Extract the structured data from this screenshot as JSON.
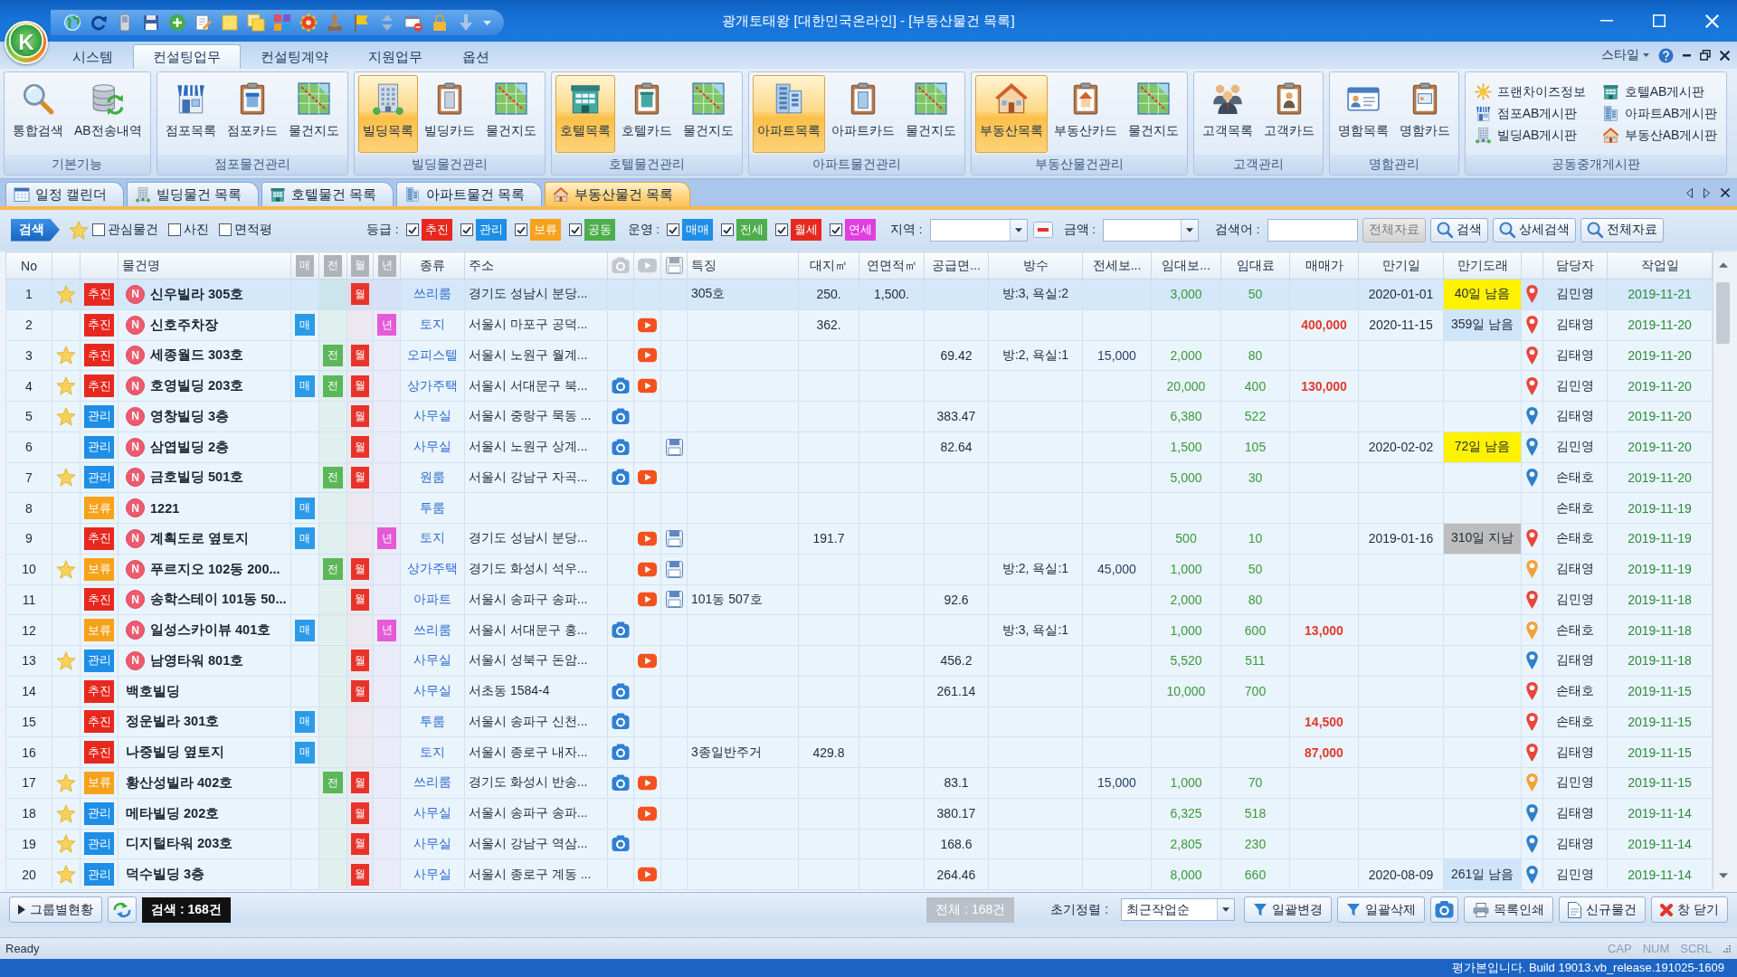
{
  "window": {
    "logo": "K",
    "title": "광개토태왕 [대한민국온라인] - [부동산물건 목록]"
  },
  "ribbon_tabs": [
    {
      "label": "시스템",
      "selected": false
    },
    {
      "label": "컨설팅업무",
      "selected": true
    },
    {
      "label": "컨설팅계약",
      "selected": false
    },
    {
      "label": "지원업무",
      "selected": false
    },
    {
      "label": "옵션",
      "selected": false
    }
  ],
  "style_menu": "스타일",
  "ribbon_groups": [
    {
      "title": "기본기능",
      "buttons": [
        {
          "label": "통합검색",
          "kind": "magnifier",
          "selected": false
        },
        {
          "label": "AB전송내역",
          "kind": "database",
          "selected": false
        }
      ]
    },
    {
      "title": "점포물건관리",
      "buttons": [
        {
          "label": "점포목록",
          "kind": "shop",
          "selected": false
        },
        {
          "label": "점포카드",
          "kind": "shop-card",
          "selected": false
        },
        {
          "label": "물건지도",
          "kind": "map",
          "selected": false
        }
      ]
    },
    {
      "title": "빌딩물건관리",
      "buttons": [
        {
          "label": "빌딩목록",
          "kind": "office",
          "selected": true
        },
        {
          "label": "빌딩카드",
          "kind": "office-card",
          "selected": false
        },
        {
          "label": "물건지도",
          "kind": "map",
          "selected": false
        }
      ]
    },
    {
      "title": "호텔물건관리",
      "buttons": [
        {
          "label": "호텔목록",
          "kind": "hotel",
          "selected": true
        },
        {
          "label": "호텔카드",
          "kind": "hotel-card",
          "selected": false
        },
        {
          "label": "물건지도",
          "kind": "map",
          "selected": false
        }
      ]
    },
    {
      "title": "아파트물건관리",
      "buttons": [
        {
          "label": "아파트목록",
          "kind": "apartment",
          "selected": true
        },
        {
          "label": "아파트카드",
          "kind": "apartment-card",
          "selected": false
        },
        {
          "label": "물건지도",
          "kind": "map",
          "selected": false
        }
      ]
    },
    {
      "title": "부동산물건관리",
      "buttons": [
        {
          "label": "부동산목록",
          "kind": "house",
          "selected": true
        },
        {
          "label": "부동산카드",
          "kind": "house-card",
          "selected": false
        },
        {
          "label": "물건지도",
          "kind": "map",
          "selected": false
        }
      ]
    },
    {
      "title": "고객관리",
      "buttons": [
        {
          "label": "고객목록",
          "kind": "people",
          "selected": false
        },
        {
          "label": "고객카드",
          "kind": "person-card",
          "selected": false
        }
      ]
    },
    {
      "title": "명함관리",
      "buttons": [
        {
          "label": "명함목록",
          "kind": "contact-list",
          "selected": false
        },
        {
          "label": "명함카드",
          "kind": "contact-card",
          "selected": false
        }
      ]
    }
  ],
  "board_group": {
    "title": "공동중개게시판",
    "links": [
      {
        "label": "프랜차이즈정보",
        "kind": "sun"
      },
      {
        "label": "호텔AB게시판",
        "kind": "hotel"
      },
      {
        "label": "점포AB게시판",
        "kind": "shop"
      },
      {
        "label": "아파트AB게시판",
        "kind": "apartment"
      },
      {
        "label": "빌딩AB게시판",
        "kind": "office"
      },
      {
        "label": "부동산AB게시판",
        "kind": "house"
      }
    ]
  },
  "doc_tabs": [
    {
      "label": "일정 캘린더",
      "kind": "calendar",
      "selected": false
    },
    {
      "label": "빌딩물건 목록",
      "kind": "office",
      "selected": false
    },
    {
      "label": "호텔물건 목록",
      "kind": "hotel",
      "selected": false
    },
    {
      "label": "아파트물건 목록",
      "kind": "apartment",
      "selected": false
    },
    {
      "label": "부동산물건 목록",
      "kind": "house",
      "selected": true
    }
  ],
  "filter_bar": {
    "search_label": "검색",
    "checks": [
      {
        "label": "관심물건",
        "checked": false
      },
      {
        "label": "사진",
        "checked": false
      },
      {
        "label": "면적평",
        "checked": false
      }
    ],
    "grade": {
      "label": "등급 :",
      "options": [
        {
          "label": "추진",
          "checked": true,
          "color": "#e8281e"
        },
        {
          "label": "관리",
          "checked": true,
          "color": "#1e8ee6"
        },
        {
          "label": "보류",
          "checked": true,
          "color": "#f7a21b"
        },
        {
          "label": "공동",
          "checked": true,
          "color": "#4cae4c"
        }
      ]
    },
    "operation": {
      "label": "운영 :",
      "options": [
        {
          "label": "매매",
          "checked": true,
          "color": "#1e8ee6"
        },
        {
          "label": "전세",
          "checked": true,
          "color": "#4cae4c"
        },
        {
          "label": "월세",
          "checked": true,
          "color": "#e8281e"
        },
        {
          "label": "연세",
          "checked": true,
          "color": "#e03ee0"
        }
      ]
    },
    "region_label": "지역 :",
    "amount_label": "금액 :",
    "keyword_label": "검색어 :",
    "buttons": [
      {
        "label": "전체자료",
        "kind": "plain",
        "disabled": true
      },
      {
        "label": "검색",
        "kind": "search",
        "disabled": false
      },
      {
        "label": "상세검색",
        "kind": "search",
        "disabled": false
      },
      {
        "label": "전체자료",
        "kind": "search",
        "disabled": false
      }
    ]
  },
  "table": {
    "columns": [
      {
        "kind": "text",
        "label": "No"
      },
      {
        "kind": "empty"
      },
      {
        "kind": "empty"
      },
      {
        "kind": "text",
        "label": "물건명"
      },
      {
        "kind": "flag",
        "label": "매"
      },
      {
        "kind": "flag",
        "label": "전"
      },
      {
        "kind": "flag",
        "label": "월"
      },
      {
        "kind": "flag",
        "label": "년"
      },
      {
        "kind": "text",
        "label": "종류"
      },
      {
        "kind": "text",
        "label": "주소"
      },
      {
        "kind": "photo"
      },
      {
        "kind": "video"
      },
      {
        "kind": "file"
      },
      {
        "kind": "text",
        "label": "특징"
      },
      {
        "kind": "text",
        "label": "대지㎡"
      },
      {
        "kind": "text",
        "label": "연면적㎡"
      },
      {
        "kind": "text",
        "label": "공급면..."
      },
      {
        "kind": "text",
        "label": "방수"
      },
      {
        "kind": "text",
        "label": "전세보..."
      },
      {
        "kind": "text",
        "label": "임대보..."
      },
      {
        "kind": "text",
        "label": "임대료"
      },
      {
        "kind": "text",
        "label": "매매가"
      },
      {
        "kind": "text",
        "label": "만기일"
      },
      {
        "kind": "text",
        "label": "만기도래"
      },
      {
        "kind": "empty"
      },
      {
        "kind": "text",
        "label": "담당자"
      },
      {
        "kind": "text",
        "label": "작업일"
      }
    ],
    "rows": [
      {
        "no": "1",
        "selected": true,
        "starred": true,
        "status": {
          "label": "추진",
          "color": "#e8281e"
        },
        "new_badge": "N",
        "name": "신우빌라 305호",
        "monthly": "월",
        "type": "쓰리룸",
        "address": "경기도 성남시 분당...",
        "photo": false,
        "video": false,
        "file": false,
        "feature": "305호",
        "land_area": "250.",
        "floor_area": "1,500.",
        "rooms": "방:3, 욕실:2",
        "deposit": "3,000",
        "rent": "50",
        "expiry": "2020-01-01",
        "due": {
          "text": "40일 남음",
          "color": "#fff200"
        },
        "pin": {
          "color": "#e8453c"
        },
        "agent": "김민영",
        "work_date": "2019-11-21"
      },
      {
        "no": "2",
        "selected": false,
        "starred": false,
        "status": {
          "label": "추진",
          "color": "#e8281e"
        },
        "new_badge": "N",
        "name": "신호주차장",
        "sale": "매",
        "yearly": "년",
        "type": "토지",
        "address": "서울시 마포구 공덕...",
        "photo": false,
        "video": true,
        "file": false,
        "land_area": "362.",
        "price": "400,000",
        "expiry": "2020-11-15",
        "due": {
          "text": "359일 남음",
          "color": "#cfe6fa"
        },
        "pin": {
          "color": "#e8453c"
        },
        "agent": "김태영",
        "work_date": "2019-11-20"
      },
      {
        "no": "3",
        "selected": false,
        "starred": true,
        "status": {
          "label": "추진",
          "color": "#e8281e"
        },
        "new_badge": "N",
        "name": "세종월드 303호",
        "jeonse": "전",
        "monthly": "월",
        "type": "오피스텔",
        "address": "서울시 노원구 월계...",
        "photo": false,
        "video": true,
        "file": false,
        "supply_area": "69.42",
        "rooms": "방:2, 욕실:1",
        "jeonse_deposit": "15,000",
        "deposit": "2,000",
        "rent": "80",
        "pin": {
          "color": "#e8453c"
        },
        "agent": "김태영",
        "work_date": "2019-11-20"
      },
      {
        "no": "4",
        "selected": false,
        "starred": true,
        "status": {
          "label": "추진",
          "color": "#e8281e"
        },
        "new_badge": "N",
        "name": "호영빌딩 203호",
        "sale": "매",
        "jeonse": "전",
        "monthly": "월",
        "type": "상가주택",
        "address": "서울시 서대문구 북...",
        "photo": true,
        "video": true,
        "file": false,
        "deposit": "20,000",
        "rent": "400",
        "price": "130,000",
        "pin": {
          "color": "#e8453c"
        },
        "agent": "김민영",
        "work_date": "2019-11-20"
      },
      {
        "no": "5",
        "selected": false,
        "starred": true,
        "status": {
          "label": "관리",
          "color": "#1e8ee6"
        },
        "new_badge": "N",
        "name": "영창빌딩 3층",
        "monthly": "월",
        "type": "사무실",
        "address": "서울시 중랑구 묵동 ...",
        "photo": true,
        "video": false,
        "file": false,
        "supply_area": "383.47",
        "deposit": "6,380",
        "rent": "522",
        "pin": {
          "color": "#2f80c8"
        },
        "agent": "김태영",
        "work_date": "2019-11-20"
      },
      {
        "no": "6",
        "selected": false,
        "starred": false,
        "status": {
          "label": "관리",
          "color": "#1e8ee6"
        },
        "new_badge": "N",
        "name": "삼엽빌딩 2층",
        "monthly": "월",
        "type": "사무실",
        "address": "서울시 노원구 상계...",
        "photo": true,
        "video": false,
        "file": true,
        "supply_area": "82.64",
        "deposit": "1,500",
        "rent": "105",
        "expiry": "2020-02-02",
        "due": {
          "text": "72일 남음",
          "color": "#fff200"
        },
        "pin": {
          "color": "#2f80c8"
        },
        "agent": "김민영",
        "work_date": "2019-11-20"
      },
      {
        "no": "7",
        "selected": false,
        "starred": true,
        "status": {
          "label": "관리",
          "color": "#1e8ee6"
        },
        "new_badge": "N",
        "name": "금호빌딩 501호",
        "jeonse": "전",
        "monthly": "월",
        "type": "원룸",
        "address": "서울시 강남구 자곡...",
        "photo": true,
        "video": true,
        "file": false,
        "deposit": "5,000",
        "rent": "30",
        "pin": {
          "color": "#2f80c8"
        },
        "agent": "손태호",
        "work_date": "2019-11-20"
      },
      {
        "no": "8",
        "selected": false,
        "starred": false,
        "status": {
          "label": "보류",
          "color": "#f7a21b"
        },
        "new_badge": "N",
        "name": "1221",
        "sale": "매",
        "type": "투룸",
        "photo": false,
        "video": false,
        "file": false,
        "agent": "손태호",
        "work_date": "2019-11-19"
      },
      {
        "no": "9",
        "selected": false,
        "starred": false,
        "status": {
          "label": "추진",
          "color": "#e8281e"
        },
        "new_badge": "N",
        "name": "계획도로 옆토지",
        "sale": "매",
        "yearly": "년",
        "type": "토지",
        "address": "경기도 성남시 분당...",
        "photo": false,
        "video": true,
        "file": true,
        "land_area": "191.7",
        "deposit": "500",
        "rent": "10",
        "expiry": "2019-01-16",
        "due": {
          "text": "310일 지남",
          "color": "#bdbdbd"
        },
        "pin": {
          "color": "#e8453c"
        },
        "agent": "손태호",
        "work_date": "2019-11-19"
      },
      {
        "no": "10",
        "selected": false,
        "starred": true,
        "status": {
          "label": "보류",
          "color": "#f7a21b"
        },
        "new_badge": "N",
        "name": "푸르지오 102동 200...",
        "jeonse": "전",
        "monthly": "월",
        "type": "상가주택",
        "address": "경기도 화성시 석우...",
        "photo": false,
        "video": true,
        "file": true,
        "rooms": "방:2, 욕실:1",
        "jeonse_deposit": "45,000",
        "deposit": "1,000",
        "rent": "50",
        "pin": {
          "color": "#f0a33a"
        },
        "agent": "김태영",
        "work_date": "2019-11-19"
      },
      {
        "no": "11",
        "selected": false,
        "starred": false,
        "status": {
          "label": "추진",
          "color": "#e8281e"
        },
        "new_badge": "N",
        "name": "송학스테이 101동 50...",
        "monthly": "월",
        "type": "아파트",
        "address": "서울시 송파구 송파...",
        "photo": false,
        "video": true,
        "file": true,
        "feature": "101동 507호",
        "supply_area": "92.6",
        "deposit": "2,000",
        "rent": "80",
        "pin": {
          "color": "#e8453c"
        },
        "agent": "김민영",
        "work_date": "2019-11-18"
      },
      {
        "no": "12",
        "selected": false,
        "starred": false,
        "status": {
          "label": "보류",
          "color": "#f7a21b"
        },
        "new_badge": "N",
        "name": "일성스카이뷰 401호",
        "sale": "매",
        "yearly": "년",
        "type": "쓰리룸",
        "address": "서울시 서대문구 홍...",
        "photo": true,
        "video": false,
        "file": false,
        "rooms": "방:3, 욕실:1",
        "deposit": "1,000",
        "rent": "600",
        "price": "13,000",
        "pin": {
          "color": "#f0a33a"
        },
        "agent": "손태호",
        "work_date": "2019-11-18"
      },
      {
        "no": "13",
        "selected": false,
        "starred": true,
        "status": {
          "label": "관리",
          "color": "#1e8ee6"
        },
        "new_badge": "N",
        "name": "남영타워 801호",
        "monthly": "월",
        "type": "사무실",
        "address": "서울시 성북구 돈암...",
        "photo": false,
        "video": true,
        "file": false,
        "supply_area": "456.2",
        "deposit": "5,520",
        "rent": "511",
        "pin": {
          "color": "#2f80c8"
        },
        "agent": "김태영",
        "work_date": "2019-11-18"
      },
      {
        "no": "14",
        "selected": false,
        "starred": false,
        "status": {
          "label": "추진",
          "color": "#e8281e"
        },
        "name": "백호빌딩",
        "monthly": "월",
        "type": "사무실",
        "address": "서초동 1584-4",
        "photo": true,
        "video": false,
        "file": false,
        "supply_area": "261.14",
        "deposit": "10,000",
        "rent": "700",
        "pin": {
          "color": "#e8453c"
        },
        "agent": "손태호",
        "work_date": "2019-11-15"
      },
      {
        "no": "15",
        "selected": false,
        "starred": false,
        "status": {
          "label": "추진",
          "color": "#e8281e"
        },
        "name": "정운빌라 301호",
        "sale": "매",
        "type": "투룸",
        "address": "서울시 송파구 신천...",
        "photo": true,
        "video": false,
        "file": false,
        "price": "14,500",
        "pin": {
          "color": "#e8453c"
        },
        "agent": "손태호",
        "work_date": "2019-11-15"
      },
      {
        "no": "16",
        "selected": false,
        "starred": false,
        "status": {
          "label": "추진",
          "color": "#e8281e"
        },
        "name": "나중빌딩 옆토지",
        "sale": "매",
        "type": "토지",
        "address": "서울시 종로구 내자...",
        "photo": true,
        "video": false,
        "file": false,
        "feature": "3종일반주거",
        "land_area": "429.8",
        "price": "87,000",
        "pin": {
          "color": "#e8453c"
        },
        "agent": "김태영",
        "work_date": "2019-11-15"
      },
      {
        "no": "17",
        "selected": false,
        "starred": true,
        "status": {
          "label": "보류",
          "color": "#f7a21b"
        },
        "name": "황산성빌라 402호",
        "jeonse": "전",
        "monthly": "월",
        "type": "쓰리룸",
        "address": "경기도 화성시 반송...",
        "photo": true,
        "video": true,
        "file": false,
        "supply_area": "83.1",
        "jeonse_deposit": "15,000",
        "deposit": "1,000",
        "rent": "70",
        "pin": {
          "color": "#f0a33a"
        },
        "agent": "김민영",
        "work_date": "2019-11-15"
      },
      {
        "no": "18",
        "selected": false,
        "starred": true,
        "status": {
          "label": "관리",
          "color": "#1e8ee6"
        },
        "name": "메타빌딩 202호",
        "monthly": "월",
        "type": "사무실",
        "address": "서울시 송파구 송파...",
        "photo": false,
        "video": true,
        "file": false,
        "supply_area": "380.17",
        "deposit": "6,325",
        "rent": "518",
        "pin": {
          "color": "#2f80c8"
        },
        "agent": "김태영",
        "work_date": "2019-11-14"
      },
      {
        "no": "19",
        "selected": false,
        "starred": true,
        "status": {
          "label": "관리",
          "color": "#1e8ee6"
        },
        "name": "디지털타워 203호",
        "monthly": "월",
        "type": "사무실",
        "address": "서울시 강남구 역삼...",
        "photo": true,
        "video": false,
        "file": false,
        "supply_area": "168.6",
        "deposit": "2,805",
        "rent": "230",
        "pin": {
          "color": "#2f80c8"
        },
        "agent": "김태영",
        "work_date": "2019-11-14"
      },
      {
        "no": "20",
        "selected": false,
        "starred": true,
        "status": {
          "label": "관리",
          "color": "#1e8ee6"
        },
        "name": "덕수빌딩 3층",
        "monthly": "월",
        "type": "사무실",
        "address": "서울시 종로구 계동 ...",
        "photo": false,
        "video": true,
        "file": false,
        "supply_area": "264.46",
        "deposit": "8,000",
        "rent": "660",
        "expiry": "2020-08-09",
        "due": {
          "text": "261일 남음",
          "color": "#cfe6fa"
        },
        "pin": {
          "color": "#2f80c8"
        },
        "agent": "김민영",
        "work_date": "2019-11-14"
      }
    ]
  },
  "bottom_bar": {
    "group_button": "그룹별현황",
    "search_count": "검색 : 168건",
    "total_count": "전체 : 168건",
    "sort_label": "초기정렬 :",
    "sort_value": "최근작업순",
    "buttons": [
      {
        "label": "일괄변경",
        "kind": "filter"
      },
      {
        "label": "일괄삭제",
        "kind": "filter"
      },
      {
        "kind": "camera"
      },
      {
        "label": "목록인쇄",
        "kind": "printer"
      },
      {
        "label": "신규물건",
        "kind": "document"
      },
      {
        "label": "창 닫기",
        "kind": "close"
      }
    ]
  },
  "status_bar": {
    "text": "Ready",
    "indicators": [
      {
        "label": "CAP",
        "on": false
      },
      {
        "label": "NUM",
        "on": false
      },
      {
        "label": "SCRL",
        "on": false
      }
    ]
  },
  "footer": "평가본입니다. Build 19013.vb_release.191025-1609"
}
